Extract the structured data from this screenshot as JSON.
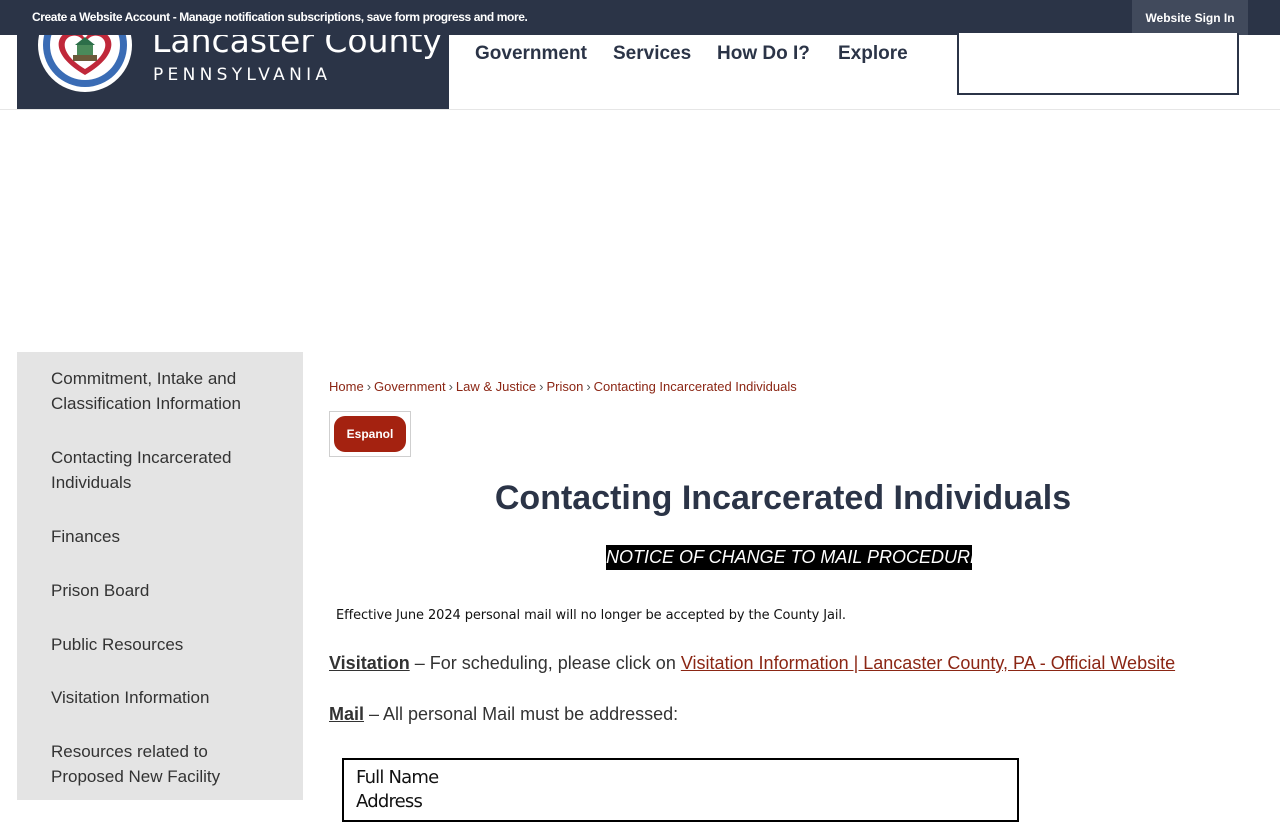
{
  "topbar": {
    "message": "Create a Website Account - Manage notification subscriptions, save form progress and more.",
    "signin": "Website Sign In"
  },
  "logo": {
    "title": "Lancaster County",
    "subtitle": "PENNSYLVANIA"
  },
  "nav": [
    "Government",
    "Services",
    "How Do I?",
    "Explore"
  ],
  "sidebar": {
    "items": [
      [
        "Commitment, Intake and",
        "Classification Information"
      ],
      [
        "Contacting Incarcerated",
        "Individuals"
      ],
      [
        "Finances"
      ],
      [
        "Prison Board"
      ],
      [
        "Public Resources"
      ],
      [
        "Visitation Information"
      ],
      [
        "Resources related to",
        "Proposed New Facility"
      ]
    ]
  },
  "breadcrumb": [
    "Home",
    "Government",
    "Law & Justice",
    "Prison",
    "Contacting Incarcerated Individuals"
  ],
  "espanol": "Espanol",
  "title": "Contacting Incarcerated Individuals",
  "notice": "NOTICE OF CHANGE TO MAIL PROCEDURES",
  "effective": "Effective June 2024 personal mail will no longer be accepted by the County Jail.",
  "visitation": {
    "label": "Visitation",
    "text": " – For scheduling, please click on ",
    "link": "Visitation Information  | Lancaster County, PA - Official Website"
  },
  "mail": {
    "label": "Mail",
    "text": " – All personal Mail must be addressed:"
  },
  "address_box": [
    "Full Name",
    "Address"
  ],
  "colors": {
    "navy": "#2b3447",
    "link": "#8b2614",
    "button": "#a42210",
    "sidebar": "#e4e4e4"
  }
}
